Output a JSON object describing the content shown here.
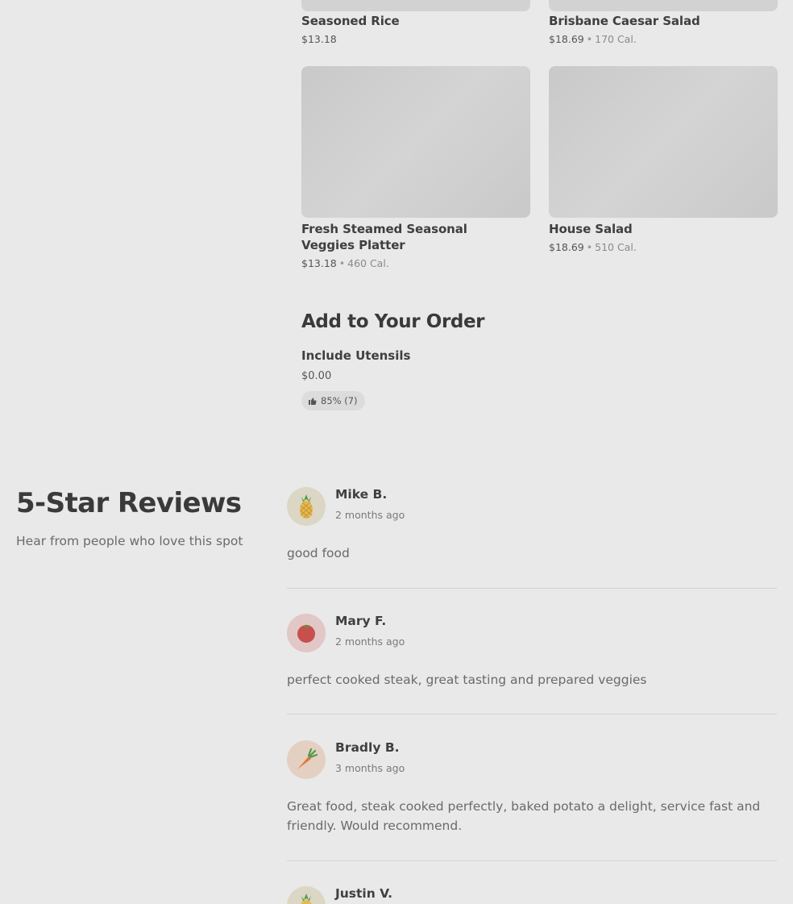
{
  "menu": {
    "items": [
      {
        "name": "Seasoned Rice",
        "price": "$13.18",
        "calories": ""
      },
      {
        "name": "Brisbane Caesar Salad",
        "price": "$18.69",
        "calories": "170 Cal."
      },
      {
        "name": "Fresh Steamed Seasonal Veggies Platter",
        "price": "$13.18",
        "calories": "460 Cal."
      },
      {
        "name": "House Salad",
        "price": "$18.69",
        "calories": "510 Cal."
      }
    ],
    "separator": "•"
  },
  "add_to_order": {
    "title": "Add to Your Order",
    "item_name": "Include Utensils",
    "item_price": "$0.00",
    "rating": "85% (7)",
    "rating_icon": "thumbs-up-icon"
  },
  "reviews": {
    "title": "5-Star Reviews",
    "subtitle": "Hear from people who love this spot",
    "list": [
      {
        "name": "Mike B.",
        "date": "2 months ago",
        "text": "good food",
        "avatar_icon": "pineapple-icon",
        "avatar_color": "#dcd6c4"
      },
      {
        "name": "Mary F.",
        "date": "2 months ago",
        "text": "perfect cooked steak, great tasting and prepared veggies",
        "avatar_icon": "tomato-icon",
        "avatar_color": "#e2c7c7"
      },
      {
        "name": "Bradly B.",
        "date": "3 months ago",
        "text": "Great food, steak cooked perfectly, baked potato a delight, service fast and friendly. Would recommend.",
        "avatar_icon": "carrot-icon",
        "avatar_color": "#e4d0c2"
      },
      {
        "name": "Justin V.",
        "date": "",
        "text": "",
        "avatar_icon": "pineapple-icon",
        "avatar_color": "#dcd6c4"
      }
    ]
  }
}
